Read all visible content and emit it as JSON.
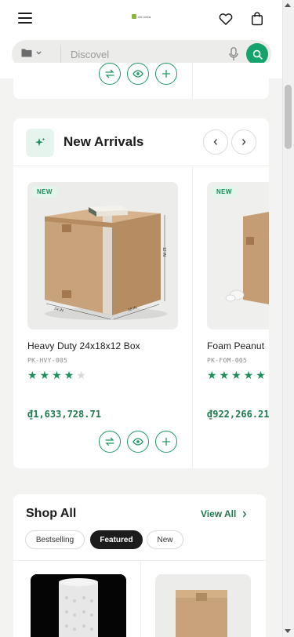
{
  "header": {
    "menu_icon": "hamburger-icon",
    "logo_text": "vie.veka",
    "wishlist_icon": "heart-icon",
    "cart_icon": "shopping-bag-icon"
  },
  "search": {
    "category_icon": "folder-icon",
    "placeholder": "Discovel",
    "mic_icon": "microphone-icon",
    "submit_icon": "search-icon"
  },
  "new_arrivals": {
    "title": "New Arrivals",
    "icon": "sparkle-icon",
    "prev_icon": "chevron-left-icon",
    "next_icon": "chevron-right-icon",
    "products": [
      {
        "badge": "NEW",
        "name": "Heavy Duty 24x18x12 Box",
        "sku": "PK-HVY-005",
        "rating": 4,
        "rating_max": 5,
        "price": "₫1,633,728.71",
        "dim_labels": [
          "24 IN",
          "18 IN",
          "12 IN"
        ]
      },
      {
        "badge": "NEW",
        "name": "Foam Peanut",
        "sku": "PK-FOM-005",
        "rating": 5,
        "rating_max": 5,
        "price": "₫922,266.21"
      }
    ]
  },
  "shop_all": {
    "title": "Shop All",
    "view_all": "View All",
    "tabs": [
      {
        "label": "Bestselling",
        "active": false
      },
      {
        "label": "Featured",
        "active": true
      },
      {
        "label": "New",
        "active": false
      }
    ]
  },
  "colors": {
    "accent": "#16a36b",
    "accent_dark": "#1d7a4e",
    "page_bg": "#f3f3f1"
  }
}
